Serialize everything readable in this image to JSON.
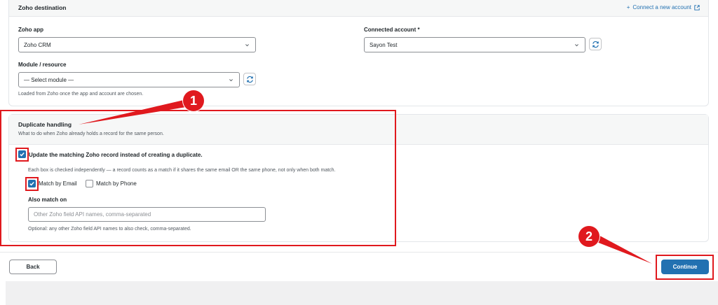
{
  "zoho_destination": {
    "title": "Zoho destination",
    "connect_link": "Connect a new account",
    "zoho_app": {
      "label": "Zoho app",
      "value": "Zoho CRM"
    },
    "connected_account": {
      "label": "Connected account *",
      "value": "Sayon Test"
    },
    "module": {
      "label": "Module / resource",
      "value": "— Select module —",
      "help": "Loaded from Zoho once the app and account are chosen."
    }
  },
  "duplicate_handling": {
    "title": "Duplicate handling",
    "description": "What to do when Zoho already holds a record for the same person.",
    "update_checkbox": {
      "label": "Update the matching Zoho record instead of creating a duplicate.",
      "checked": true
    },
    "match_help": "Each box is checked independently — a record counts as a match if it shares the same email OR the same phone, not only when both match.",
    "match_email": {
      "label": "Match by Email",
      "checked": true
    },
    "match_phone": {
      "label": "Match by Phone",
      "checked": false
    },
    "also_match": {
      "label": "Also match on",
      "placeholder": "Other Zoho field API names, comma-separated",
      "help": "Optional: any other Zoho field API names to also check, comma-separated."
    }
  },
  "footer": {
    "back_label": "Back",
    "continue_label": "Continue"
  },
  "annotations": {
    "badge_1": "1",
    "badge_2": "2",
    "color": "#e0191e"
  },
  "colors": {
    "accent": "#2271b1",
    "border": "#8c8f94",
    "header_bg": "#f6f7f7"
  }
}
